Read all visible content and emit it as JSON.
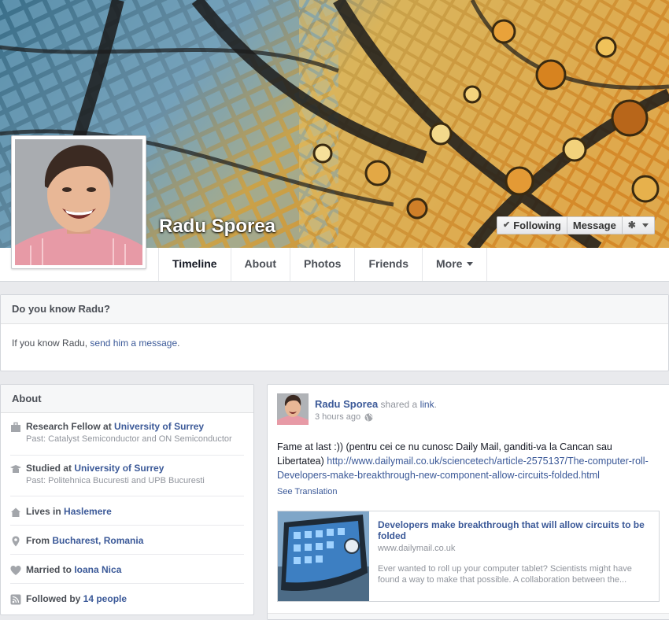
{
  "profile": {
    "name": "Radu Sporea"
  },
  "cover_actions": {
    "following": "Following",
    "message": "Message"
  },
  "nav": {
    "tabs": [
      {
        "label": "Timeline"
      },
      {
        "label": "About"
      },
      {
        "label": "Photos"
      },
      {
        "label": "Friends"
      },
      {
        "label": "More"
      }
    ]
  },
  "know": {
    "title": "Do you know Radu?",
    "prefix": "If you know Radu, ",
    "link": "send him a message",
    "suffix": "."
  },
  "about": {
    "title": "About",
    "items": [
      {
        "icon": "briefcase-icon",
        "pre": "Research Fellow at ",
        "strong": "University of Surrey",
        "sub": "Past: Catalyst Semiconductor and ON Semiconductor"
      },
      {
        "icon": "graduation-cap-icon",
        "pre": "Studied at ",
        "strong": "University of Surrey",
        "sub": "Past: Politehnica Bucuresti and UPB Bucuresti"
      },
      {
        "icon": "house-icon",
        "pre": "Lives in ",
        "strong": "Haslemere",
        "sub": ""
      },
      {
        "icon": "location-pin-icon",
        "pre": "From ",
        "strong": "Bucharest, Romania",
        "sub": ""
      },
      {
        "icon": "heart-icon",
        "pre": "Married to ",
        "strong": "Ioana Nica",
        "sub": ""
      },
      {
        "icon": "rss-icon",
        "pre": "Followed by ",
        "strong": "14 people",
        "sub": ""
      }
    ]
  },
  "post": {
    "author": "Radu Sporea",
    "action_pre": " shared a ",
    "action_link": "link",
    "action_post": ".",
    "time": "3 hours ago",
    "text": "Fame at last :)) (pentru cei ce nu cunosc Daily Mail, ganditi-va la Cancan sau Libertatea) ",
    "url": "http://www.dailymail.co.uk/sciencetech/article-2575137/The-computer-roll-Developers-make-breakthrough-new-component-allow-circuits-folded.html",
    "see_translation": "See Translation",
    "share": {
      "title": "Developers make breakthrough that will allow circuits to be folded",
      "domain": "www.dailymail.co.uk",
      "description": "Ever wanted to roll up your computer tablet? Scientists might have found a way to make that possible. A collaboration between the..."
    }
  },
  "colors": {
    "link": "#3b5998",
    "background": "#e9eaed",
    "muted": "#90949c"
  }
}
